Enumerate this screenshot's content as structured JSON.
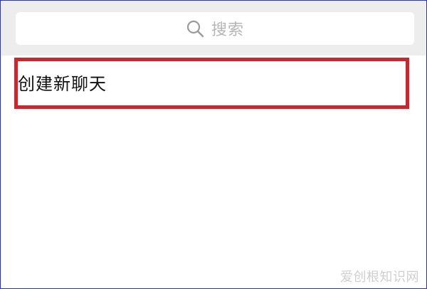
{
  "search": {
    "icon": "search-icon",
    "placeholder": "搜索"
  },
  "list": {
    "items": [
      {
        "label": "创建新聊天"
      }
    ]
  },
  "annotation": {
    "highlight_color": "#d0232b"
  },
  "watermark": {
    "text": "爱创根知识网"
  },
  "frame": {
    "border_color": "#1e2bff"
  }
}
